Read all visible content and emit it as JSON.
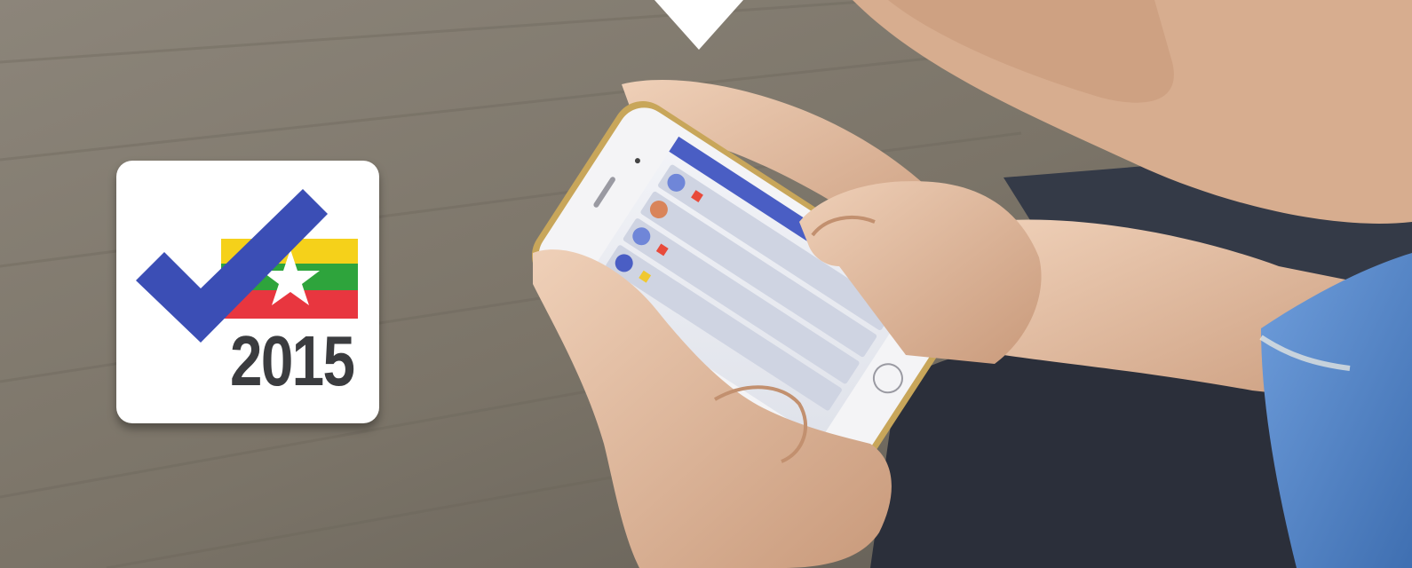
{
  "logo": {
    "year": "2015",
    "icon": "check-flag-icon",
    "colors": {
      "check": "#3b4eb5",
      "flag_yellow": "#f5d11a",
      "flag_green": "#2ea43c",
      "flag_red": "#e8363f",
      "star": "#ffffff",
      "year_text": "#3b3c3f"
    }
  },
  "photo": {
    "icon": "hand-holding-phone-photo",
    "colors": {
      "floor": "#7b7468",
      "sleeve": "#5d8fd0",
      "skin": "#e4c0a4",
      "screen_header": "#4a5ec4"
    }
  }
}
